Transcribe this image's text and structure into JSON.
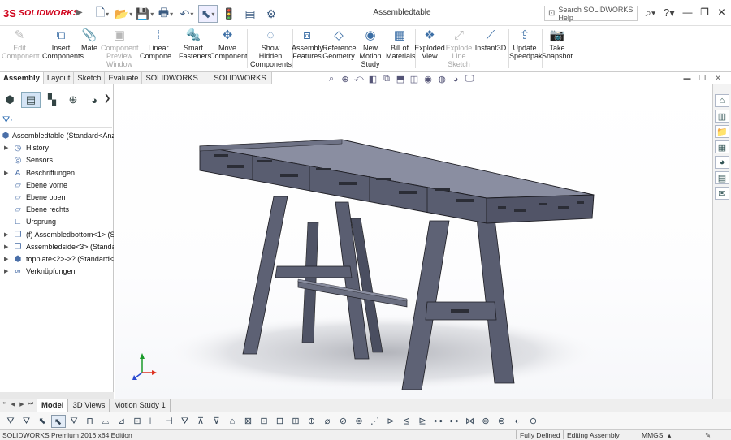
{
  "app": {
    "logo_mark": "3S",
    "logo_text": "SOLIDWORKS",
    "document_title": "Assembledtable",
    "search_placeholder": "Search SOLIDWORKS Help",
    "accent_color": "#d0021b"
  },
  "quick_access": [
    {
      "icon": "new-document-icon",
      "glyph": "🗋"
    },
    {
      "icon": "open-icon",
      "glyph": "📂"
    },
    {
      "icon": "save-icon",
      "glyph": "💾"
    },
    {
      "icon": "print-icon",
      "glyph": "🖶"
    },
    {
      "icon": "undo-icon",
      "glyph": "↶"
    },
    {
      "icon": "select-icon",
      "glyph": "⬉"
    },
    {
      "icon": "rebuild-icon",
      "glyph": "🚦"
    },
    {
      "icon": "file-properties-icon",
      "glyph": "▤"
    },
    {
      "icon": "options-icon",
      "glyph": "⚙"
    }
  ],
  "ribbon": [
    {
      "label": "Edit Component",
      "lines": [
        "Edit",
        "Component"
      ],
      "enabled": false,
      "icon": "edit-component-icon",
      "glyph": "✎"
    },
    {
      "label": "Insert Components",
      "lines": [
        "Insert",
        "Components"
      ],
      "enabled": true,
      "icon": "insert-components-icon",
      "glyph": "⧉"
    },
    {
      "label": "Mate",
      "lines": [
        "Mate"
      ],
      "enabled": true,
      "icon": "mate-icon",
      "glyph": "📎"
    },
    {
      "label": "Component Preview Window",
      "lines": [
        "Component",
        "Preview",
        "Window"
      ],
      "enabled": false,
      "icon": "component-preview-icon",
      "glyph": "▣"
    },
    {
      "label": "Linear Component Pattern",
      "lines": [
        "Linear",
        "Compone…"
      ],
      "enabled": true,
      "icon": "linear-pattern-icon",
      "glyph": "⁞"
    },
    {
      "label": "Smart Fasteners",
      "lines": [
        "Smart",
        "Fasteners"
      ],
      "enabled": true,
      "icon": "smart-fasteners-icon",
      "glyph": "🔩"
    },
    {
      "label": "Move Component",
      "lines": [
        "Move",
        "Component"
      ],
      "enabled": true,
      "icon": "move-component-icon",
      "glyph": "✥"
    },
    {
      "label": "Show Hidden Components",
      "lines": [
        "Show",
        "Hidden",
        "Components"
      ],
      "enabled": true,
      "icon": "show-hidden-icon",
      "glyph": "◌"
    },
    {
      "label": "Assembly Features",
      "lines": [
        "Assembly",
        "Features"
      ],
      "enabled": true,
      "icon": "assembly-features-icon",
      "glyph": "⧈"
    },
    {
      "label": "Reference Geometry",
      "lines": [
        "Reference",
        "Geometry"
      ],
      "enabled": true,
      "icon": "reference-geometry-icon",
      "glyph": "◇"
    },
    {
      "label": "New Motion Study",
      "lines": [
        "New",
        "Motion",
        "Study"
      ],
      "enabled": true,
      "icon": "motion-study-icon",
      "glyph": "◉"
    },
    {
      "label": "Bill of Materials",
      "lines": [
        "Bill of",
        "Materials"
      ],
      "enabled": true,
      "icon": "bom-icon",
      "glyph": "▦"
    },
    {
      "label": "Exploded View",
      "lines": [
        "Exploded",
        "View"
      ],
      "enabled": true,
      "icon": "exploded-view-icon",
      "glyph": "❖"
    },
    {
      "label": "Explode Line Sketch",
      "lines": [
        "Explode",
        "Line",
        "Sketch"
      ],
      "enabled": false,
      "icon": "explode-line-icon",
      "glyph": "⤢"
    },
    {
      "label": "Instant3D",
      "lines": [
        "Instant3D"
      ],
      "enabled": true,
      "icon": "instant3d-icon",
      "glyph": "⟋"
    },
    {
      "label": "Update Speedpak",
      "lines": [
        "Update",
        "Speedpak"
      ],
      "enabled": true,
      "icon": "speedpak-icon",
      "glyph": "⇪"
    },
    {
      "label": "Take Snapshot",
      "lines": [
        "Take",
        "Snapshot"
      ],
      "enabled": true,
      "icon": "snapshot-icon",
      "glyph": "📷"
    }
  ],
  "command_tabs": [
    {
      "label": "Assembly",
      "active": true
    },
    {
      "label": "Layout",
      "active": false
    },
    {
      "label": "Sketch",
      "active": false
    },
    {
      "label": "Evaluate",
      "active": false
    },
    {
      "label": "SOLIDWORKS Add-Ins",
      "active": false
    },
    {
      "label": "SOLIDWORKS MBD",
      "active": false
    }
  ],
  "feature_tree": {
    "root": "Assembledtable  (Standard<Anz",
    "items": [
      {
        "label": "History",
        "icon": "history-icon",
        "glyph": "◷",
        "expandable": true
      },
      {
        "label": "Sensors",
        "icon": "sensors-icon",
        "glyph": "◎",
        "expandable": false
      },
      {
        "label": "Beschriftungen",
        "icon": "annotations-icon",
        "glyph": "A",
        "expandable": true
      },
      {
        "label": "Ebene vorne",
        "icon": "plane-icon",
        "glyph": "▱",
        "expandable": false
      },
      {
        "label": "Ebene oben",
        "icon": "plane-icon",
        "glyph": "▱",
        "expandable": false
      },
      {
        "label": "Ebene rechts",
        "icon": "plane-icon",
        "glyph": "▱",
        "expandable": false
      },
      {
        "label": "Ursprung",
        "icon": "origin-icon",
        "glyph": "∟",
        "expandable": false
      },
      {
        "label": "(f) Assembledbottom<1> (S",
        "icon": "subassembly-icon",
        "glyph": "❐",
        "expandable": true
      },
      {
        "label": "Assembledside<3> (Standar",
        "icon": "subassembly-icon",
        "glyph": "❐",
        "expandable": true
      },
      {
        "label": "topplate<2>->? (Standard<",
        "icon": "part-icon",
        "glyph": "⬢",
        "expandable": true
      },
      {
        "label": "Verknüpfungen",
        "icon": "mates-icon",
        "glyph": "∞",
        "expandable": true
      }
    ]
  },
  "bottom_tabs": [
    {
      "label": "Model",
      "active": true
    },
    {
      "label": "3D Views",
      "active": false
    },
    {
      "label": "Motion Study 1",
      "active": false
    }
  ],
  "status": {
    "product": "SOLIDWORKS Premium 2016 x64 Edition",
    "state": "Fully Defined",
    "mode": "Editing Assembly",
    "units": "MMGS"
  },
  "model_color": "#5c6072"
}
